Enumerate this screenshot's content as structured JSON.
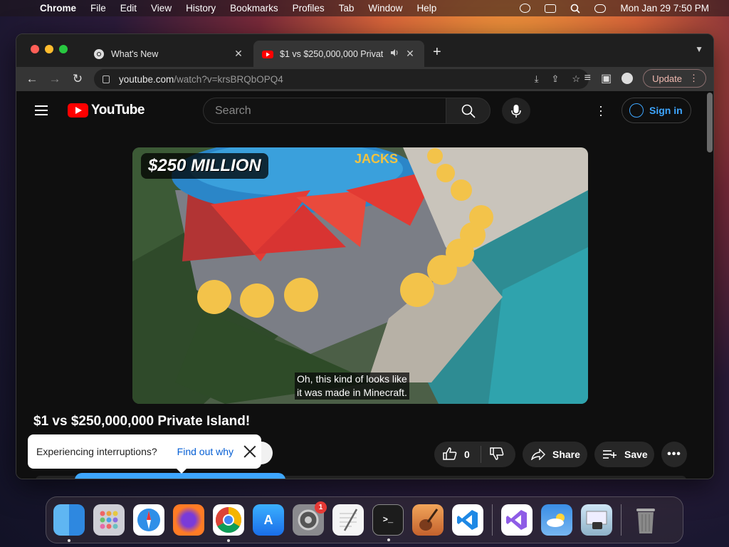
{
  "menubar": {
    "app": "Chrome",
    "items": [
      "File",
      "Edit",
      "View",
      "History",
      "Bookmarks",
      "Profiles",
      "Tab",
      "Window",
      "Help"
    ],
    "clock": "Mon Jan 29  7:50 PM"
  },
  "tabs": [
    {
      "title": "What's New",
      "icon": "chrome-icon"
    },
    {
      "title": "$1 vs $250,000,000 Privat",
      "icon": "youtube-icon",
      "audio": "speaker-icon"
    }
  ],
  "toolbar": {
    "url_host": "youtube.com",
    "url_path": "/watch?v=krsBRQbOPQ4",
    "update_label": "Update"
  },
  "youtube": {
    "logo_text": "YouTube",
    "search_placeholder": "Search",
    "signin_label": "Sign in",
    "video": {
      "overlay_text": "$250 MILLION",
      "caption_line1": "Oh, this kind of looks like",
      "caption_line2": "it was made in Minecraft."
    },
    "title": "$1 vs $250,000,000 Private Island!",
    "like_count": "0",
    "share_label": "Share",
    "save_label": "Save",
    "popup": {
      "text": "Experiencing interruptions?",
      "link": "Find out why"
    }
  },
  "dock": {
    "items": [
      "Finder",
      "Launchpad",
      "Safari",
      "Firefox",
      "Chrome",
      "App Store",
      "System Settings",
      "TextEdit",
      "Terminal",
      "GarageBand",
      "Visual Studio Code",
      "Visual Studio",
      "Weather",
      "Preview",
      "Trash"
    ],
    "settings_badge": "1"
  },
  "colors": {
    "yt_red": "#ff0000",
    "link_blue": "#3ea6ff",
    "update_border": "#8b6f6f"
  }
}
